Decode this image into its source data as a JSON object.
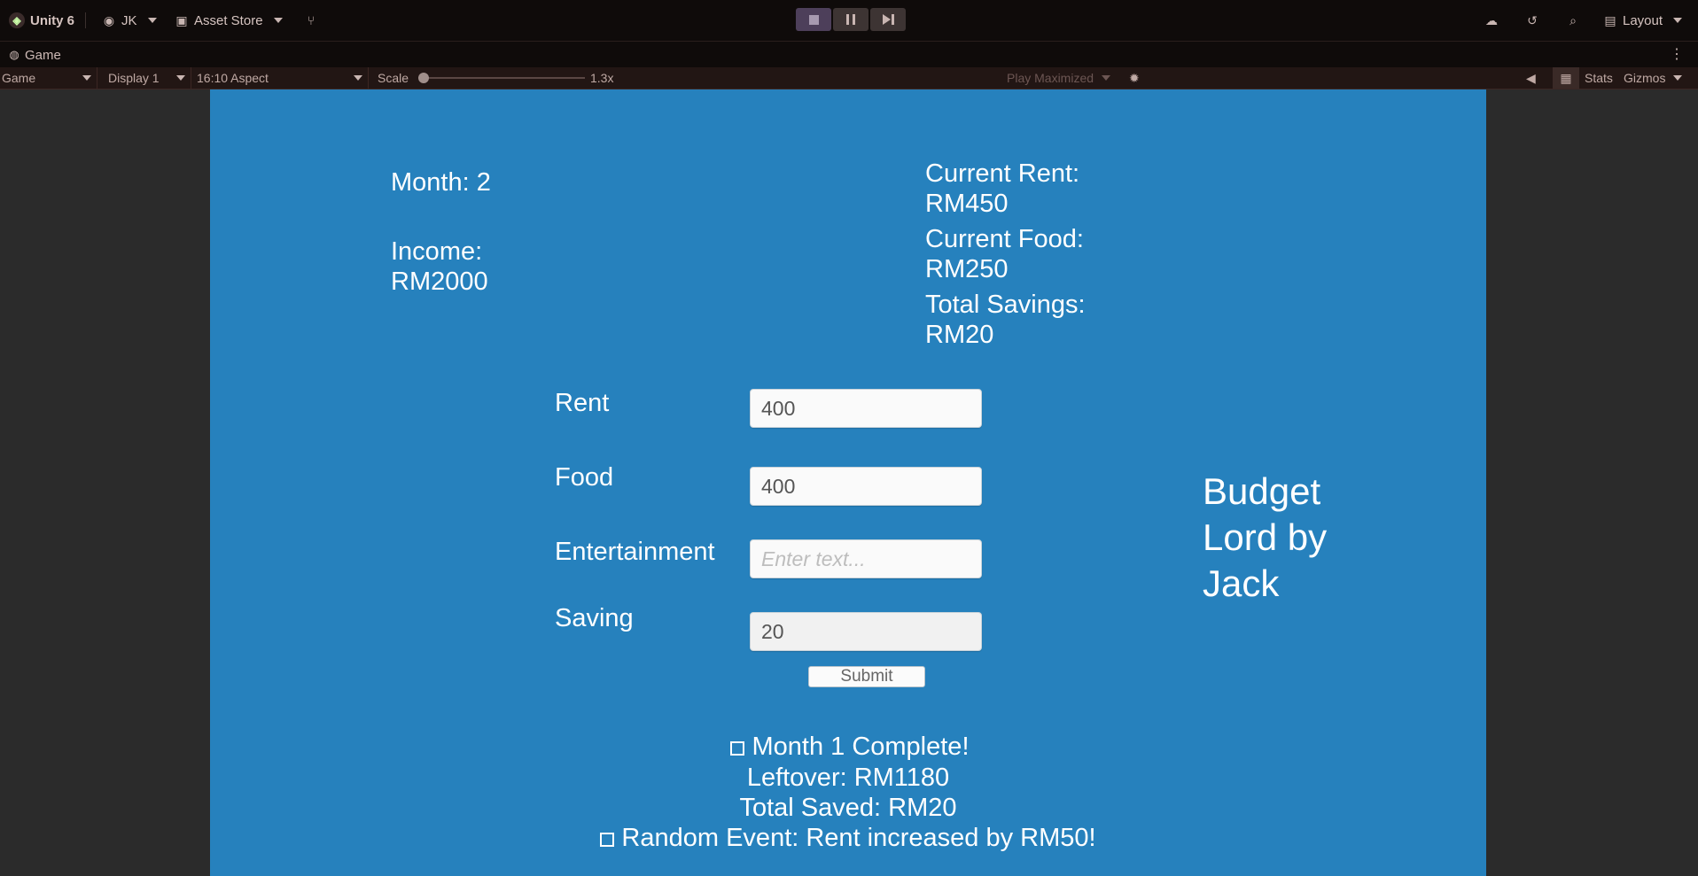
{
  "editor": {
    "app_name": "Unity 6",
    "account": "JK",
    "asset_store": "Asset Store",
    "layout": "Layout"
  },
  "game_tab": {
    "label": "Game",
    "controls": {
      "view_mode": "Game",
      "display": "Display 1",
      "aspect": "16:10 Aspect",
      "scale_label": "Scale",
      "scale_value": "1.3x",
      "play_maximized": "Play Maximized",
      "stats": "Stats",
      "gizmos": "Gizmos"
    }
  },
  "game": {
    "month": "Month: 2",
    "income": "Income:\nRM2000",
    "current_rent": "Current Rent:\nRM450",
    "current_food": "Current Food:\nRM250",
    "total_savings": "Total Savings:\nRM20",
    "form": {
      "rent_label": "Rent",
      "rent_value": "400",
      "food_label": "Food",
      "food_value": "400",
      "entertainment_label": "Entertainment",
      "entertainment_placeholder": "Enter text...",
      "saving_label": "Saving",
      "saving_value": "20",
      "submit_label": "Submit"
    },
    "results": {
      "month_complete": "Month 1 Complete!",
      "leftover": "Leftover: RM1180",
      "total_saved": "Total Saved: RM20",
      "random_event": "Random Event: Rent increased by RM50!"
    },
    "title": "Budget\nLord by\nJack"
  }
}
